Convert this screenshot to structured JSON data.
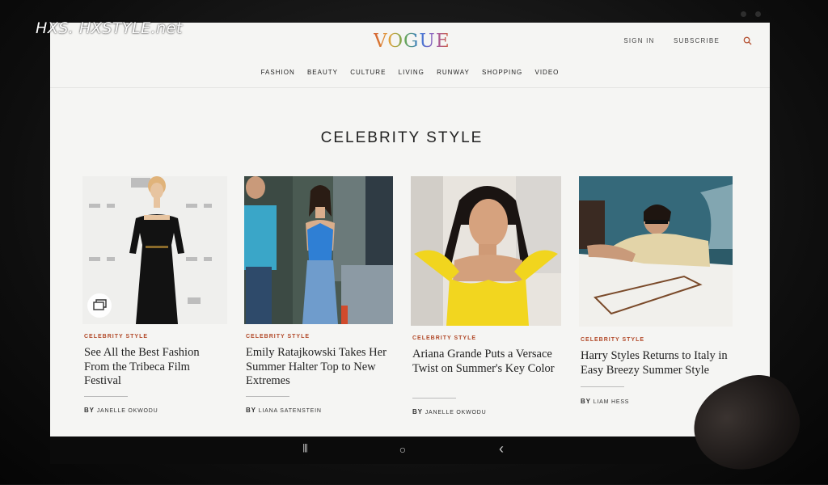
{
  "watermark": "HXS. HXSTYLE.net",
  "site": {
    "logo": "VOGUE",
    "sign_in": "SIGN IN",
    "subscribe": "SUBSCRIBE",
    "nav": [
      "FASHION",
      "BEAUTY",
      "CULTURE",
      "LIVING",
      "RUNWAY",
      "SHOPPING",
      "VIDEO"
    ]
  },
  "section_title": "CELEBRITY STYLE",
  "cards": [
    {
      "rubric": "CELEBRITY STYLE",
      "headline": "See All the Best Fashion From the Tribeca Film Festival",
      "by": "BY",
      "author": "JANELLE OKWODU",
      "has_gallery_icon": true
    },
    {
      "rubric": "CELEBRITY STYLE",
      "headline": "Emily Ratajkowski Takes Her Summer Halter Top to New Extremes",
      "by": "BY",
      "author": "LIANA SATENSTEIN"
    },
    {
      "rubric": "CELEBRITY STYLE",
      "headline": "Ariana Grande Puts a Versace Twist on Summer's Key Color",
      "by": "BY",
      "author": "JANELLE OKWODU"
    },
    {
      "rubric": "CELEBRITY STYLE",
      "headline": "Harry Styles Returns to Italy in Easy Breezy Summer Style",
      "by": "BY",
      "author": "LIAM HESS"
    }
  ],
  "android_nav": {
    "recents": "|||",
    "home": "○",
    "back": "‹"
  },
  "colors": {
    "accent": "#b24a2a",
    "screen_bg": "#f5f5f3",
    "text": "#222222"
  }
}
